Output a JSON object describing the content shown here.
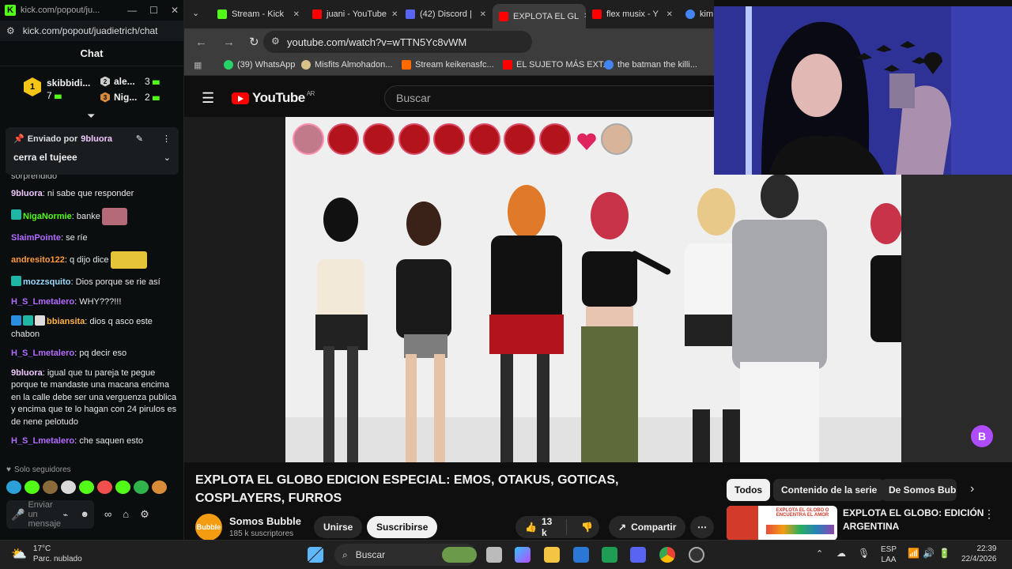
{
  "kick_window": {
    "title": "kick.com/popout/ju...",
    "url": "kick.com/popout/juadietrich/chat",
    "chat_title": "Chat",
    "leaderboard": [
      {
        "rank": "1",
        "name": "skibbidi...",
        "count": "7"
      },
      {
        "rank": "2",
        "name": "ale...",
        "count": "3"
      },
      {
        "rank": "3",
        "name": "Nig...",
        "count": "2"
      }
    ],
    "pinned": {
      "label": "Enviado por",
      "user": "9bluora",
      "message": "cerra el tujeee"
    },
    "partial_message": "sorprendido",
    "messages": [
      {
        "user": "9bluora",
        "color": "#f0c8ff",
        "text": "ni sabe que responder"
      },
      {
        "user": "NigaNormie",
        "color": "#53fc18",
        "text": "banke"
      },
      {
        "user": "SlaimPointe",
        "color": "#b36bff",
        "text": "se ríe"
      },
      {
        "user": "andresito122",
        "color": "#ff9a3c",
        "text": "q dijo dice"
      },
      {
        "user": "mozzsquito",
        "color": "#9ad8ff",
        "text": "Dios porque se rie así"
      },
      {
        "user": "H_S_Lmetalero",
        "color": "#b36bff",
        "text": "WHY???!!!"
      },
      {
        "user": "bbiansita",
        "color": "#ffb347",
        "text": "dios q asco este chabon"
      },
      {
        "user": "H_S_Lmetalero",
        "color": "#b36bff",
        "text": "pq decir eso"
      },
      {
        "user": "9bluora",
        "color": "#f0c8ff",
        "text": "igual que tu pareja te pegue porque te mandaste una macana encima en la calle debe ser una verguenza publica y encima que te lo hagan con 24 pirulos es de nene pelotudo"
      },
      {
        "user": "H_S_Lmetalero",
        "color": "#b36bff",
        "text": "che saquen esto"
      }
    ],
    "followers_only": "Solo seguidores",
    "input_placeholder": "Enviar un mensaje"
  },
  "browser": {
    "tabs": [
      {
        "title": "Stream - Kick",
        "fav": "#53fc18"
      },
      {
        "title": "juani - YouTube",
        "fav": "#ff0000"
      },
      {
        "title": "(42) Discord |",
        "fav": "#5865f2"
      },
      {
        "title": "EXPLOTA EL GL",
        "fav": "#ff0000"
      },
      {
        "title": "flex musix - Y",
        "fav": "#ff0000"
      },
      {
        "title": "kim",
        "fav": "#4285f4"
      }
    ],
    "url": "youtube.com/watch?v=wTTN5Yc8vWM",
    "bookmarks": [
      "(39) WhatsApp",
      "Misfits Almohadon...",
      "Stream keikenasfc...",
      "EL SUJETO MÁS EXT...",
      "the batman the killi..."
    ]
  },
  "youtube": {
    "logo": "YouTube",
    "region": "AR",
    "search_placeholder": "Buscar",
    "video_title": "EXPLOTA EL GLOBO EDICION ESPECIAL: EMOS, OTAKUS, GOTICAS, COSPLAYERS, FURROS",
    "channel": "Somos Bubble",
    "subscribers": "185 k suscriptores",
    "join": "Unirse",
    "subscribe": "Suscribirse",
    "likes": "13 k",
    "share": "Compartir",
    "chips": [
      "Todos",
      "Contenido de la serie",
      "De Somos Bubble"
    ],
    "recommended_title": "EXPLOTA EL GLOBO: EDICIÓN ARGENTINA",
    "thumb_text": "EXPLOTA EL GLOBO O ENCUENTRA EL AMOR",
    "avatar_text": "Bubble"
  },
  "taskbar": {
    "temp": "17°C",
    "weather": "Parc. nublado",
    "search": "Buscar",
    "lang": "ESP",
    "lang2": "LAA",
    "time": "22:39",
    "date": "22/4/2026"
  }
}
